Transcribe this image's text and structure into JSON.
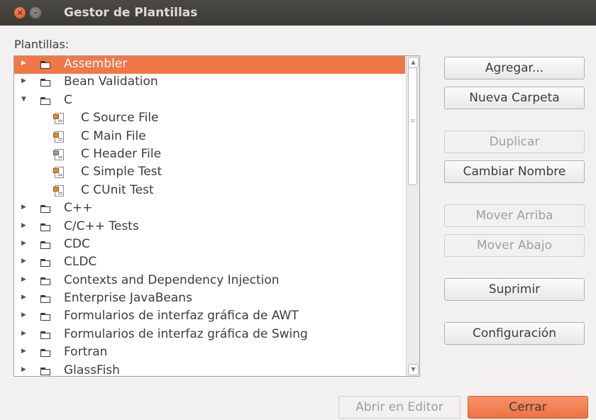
{
  "window": {
    "title": "Gestor de Plantillas"
  },
  "templates_label": "Plantillas:",
  "tree": [
    {
      "label": "Assembler",
      "type": "folder",
      "state": "collapsed",
      "selected": true
    },
    {
      "label": "Bean Validation",
      "type": "folder",
      "state": "collapsed"
    },
    {
      "label": "C",
      "type": "folder",
      "state": "expanded"
    },
    {
      "label": "C Source File",
      "type": "file"
    },
    {
      "label": "C Main File",
      "type": "file"
    },
    {
      "label": "C Header File",
      "type": "file",
      "variant": "gray"
    },
    {
      "label": "C Simple Test",
      "type": "file"
    },
    {
      "label": "C CUnit Test",
      "type": "file"
    },
    {
      "label": "C++",
      "type": "folder",
      "state": "collapsed"
    },
    {
      "label": "C/C++ Tests",
      "type": "folder",
      "state": "collapsed"
    },
    {
      "label": "CDC",
      "type": "folder",
      "state": "collapsed"
    },
    {
      "label": "CLDC",
      "type": "folder",
      "state": "collapsed"
    },
    {
      "label": "Contexts and Dependency Injection",
      "type": "folder",
      "state": "collapsed"
    },
    {
      "label": "Enterprise JavaBeans",
      "type": "folder",
      "state": "collapsed"
    },
    {
      "label": "Formularios de interfaz gráfica de AWT",
      "type": "folder",
      "state": "collapsed"
    },
    {
      "label": "Formularios de interfaz gráfica de Swing",
      "type": "folder",
      "state": "collapsed"
    },
    {
      "label": "Fortran",
      "type": "folder",
      "state": "collapsed"
    },
    {
      "label": "GlassFish",
      "type": "folder",
      "state": "collapsed"
    }
  ],
  "buttons": {
    "agregar": "Agregar...",
    "nueva_carpeta": "Nueva Carpeta",
    "duplicar": "Duplicar",
    "cambiar_nombre": "Cambiar Nombre",
    "mover_arriba": "Mover Arriba",
    "mover_abajo": "Mover Abajo",
    "suprimir": "Suprimir",
    "configuracion": "Configuración",
    "abrir_en_editor": "Abrir en Editor",
    "cerrar": "Cerrar"
  },
  "colors": {
    "selection": "#f07746",
    "titlebar": "#3c3b37",
    "primary_button": "#ee7244"
  }
}
